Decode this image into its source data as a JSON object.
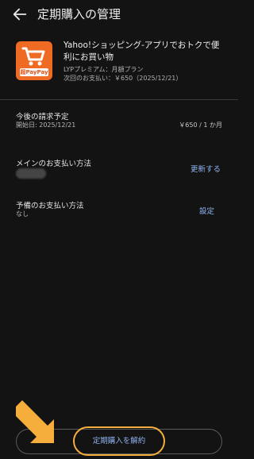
{
  "header": {
    "title": "定期購入の管理",
    "back_icon": "back-arrow-icon"
  },
  "product": {
    "icon_name": "shopping-cart-app-icon",
    "icon_badge": "超PayPay",
    "name": "Yahoo!ショッピング-アプリでおトクで便利にお買い物",
    "plan": "LYPプレミアム：月額プラン",
    "next_payment": "次回のお支払い：￥650（2025/12/21）"
  },
  "billing": {
    "label": "今後の請求予定",
    "start": "開始日: 2025/12/21",
    "price": "￥650 / 1 か月"
  },
  "main_payment": {
    "label": "メインのお支払い方法",
    "action": "更新する"
  },
  "backup_payment": {
    "label": "予備のお支払い方法",
    "value": "なし",
    "action": "設定"
  },
  "cancel": {
    "label": "定期購入を解約"
  },
  "colors": {
    "background": "#131313",
    "accent_link": "#8fb3f0",
    "highlight": "#f5ad3c",
    "icon_orange": "#ef6a22"
  }
}
